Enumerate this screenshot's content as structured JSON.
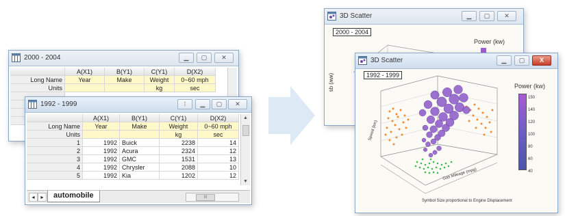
{
  "back_sheet": {
    "title": "2000 - 2004",
    "columns": [
      "A(X1)",
      "B(Y1)",
      "C(Y1)",
      "D(X2)"
    ],
    "row_labels": [
      "Long Name",
      "Units"
    ],
    "long_names": [
      "Year",
      "Make",
      "Weight",
      "0~60 mph"
    ],
    "units": [
      "",
      "",
      "kg",
      "sec"
    ]
  },
  "front_sheet": {
    "title": "1992 - 1999",
    "columns": [
      "A(X1)",
      "B(Y1)",
      "C(Y1)",
      "D(X2)"
    ],
    "row_labels": [
      "Long Name",
      "Units"
    ],
    "long_names": [
      "Year",
      "Make",
      "Weight",
      "0~60 mph"
    ],
    "units": [
      "",
      "",
      "kg",
      "sec"
    ],
    "rows": [
      {
        "n": "1",
        "year": "1992",
        "make": "Buick",
        "weight": "2238",
        "acc": "14"
      },
      {
        "n": "2",
        "year": "1992",
        "make": "Acura",
        "weight": "2324",
        "acc": "12"
      },
      {
        "n": "3",
        "year": "1992",
        "make": "GMC",
        "weight": "1531",
        "acc": "13"
      },
      {
        "n": "4",
        "year": "1992",
        "make": "Chrysler",
        "weight": "2088",
        "acc": "10"
      },
      {
        "n": "5",
        "year": "1992",
        "make": "Kia",
        "weight": "1202",
        "acc": "12"
      }
    ],
    "sheet_tab": "automobile",
    "nav_left": "◂",
    "nav_right": "▸",
    "hscroll_mark": "III"
  },
  "back_graph": {
    "title": "3D Scatter",
    "label": "2000 - 2004",
    "legend_title": "Power (kw)",
    "axis_label": "(ww) qs"
  },
  "front_graph": {
    "title": "3D Scatter",
    "label": "1992 - 1999",
    "colorbar_title": "Power (kw)",
    "colorbar_ticks": [
      "150",
      "140",
      "120",
      "100",
      "80",
      "60",
      "40"
    ],
    "z_label": "Speed (km)",
    "x_label": "Gas Mileage (mpg)",
    "bottom_label": "Symbol Size proportional to Engine Displacement",
    "close_symbol": "X"
  },
  "colors": {
    "title_bar": "#d6e3f1",
    "highlight_row": "#fff8c8",
    "bubble": "#8e5cc9",
    "orange_points": "#f08a2a",
    "green_points": "#3cb84a",
    "arrow": "#dde9f4"
  }
}
